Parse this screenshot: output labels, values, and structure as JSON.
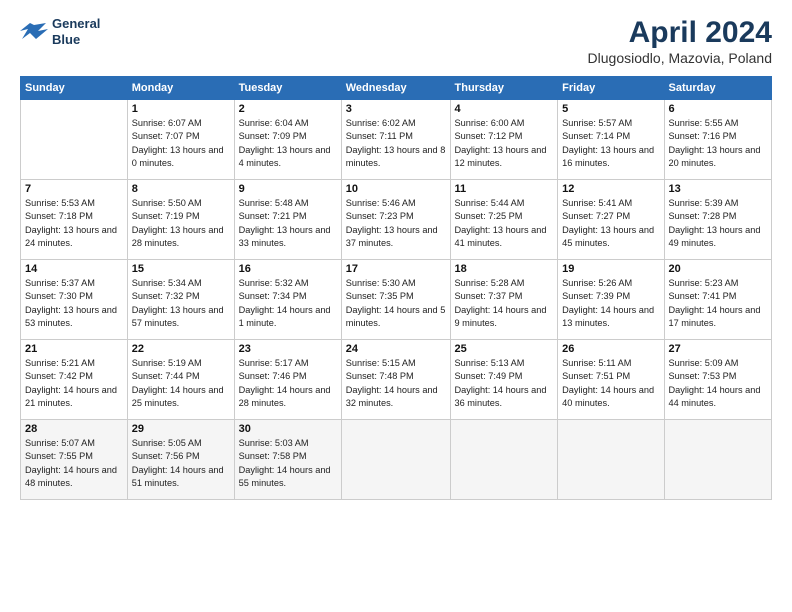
{
  "header": {
    "logo_line1": "General",
    "logo_line2": "Blue",
    "month": "April 2024",
    "location": "Dlugosiodlo, Mazovia, Poland"
  },
  "days_of_week": [
    "Sunday",
    "Monday",
    "Tuesday",
    "Wednesday",
    "Thursday",
    "Friday",
    "Saturday"
  ],
  "weeks": [
    [
      {
        "day": "",
        "sunrise": "",
        "sunset": "",
        "daylight": ""
      },
      {
        "day": "1",
        "sunrise": "Sunrise: 6:07 AM",
        "sunset": "Sunset: 7:07 PM",
        "daylight": "Daylight: 13 hours and 0 minutes."
      },
      {
        "day": "2",
        "sunrise": "Sunrise: 6:04 AM",
        "sunset": "Sunset: 7:09 PM",
        "daylight": "Daylight: 13 hours and 4 minutes."
      },
      {
        "day": "3",
        "sunrise": "Sunrise: 6:02 AM",
        "sunset": "Sunset: 7:11 PM",
        "daylight": "Daylight: 13 hours and 8 minutes."
      },
      {
        "day": "4",
        "sunrise": "Sunrise: 6:00 AM",
        "sunset": "Sunset: 7:12 PM",
        "daylight": "Daylight: 13 hours and 12 minutes."
      },
      {
        "day": "5",
        "sunrise": "Sunrise: 5:57 AM",
        "sunset": "Sunset: 7:14 PM",
        "daylight": "Daylight: 13 hours and 16 minutes."
      },
      {
        "day": "6",
        "sunrise": "Sunrise: 5:55 AM",
        "sunset": "Sunset: 7:16 PM",
        "daylight": "Daylight: 13 hours and 20 minutes."
      }
    ],
    [
      {
        "day": "7",
        "sunrise": "Sunrise: 5:53 AM",
        "sunset": "Sunset: 7:18 PM",
        "daylight": "Daylight: 13 hours and 24 minutes."
      },
      {
        "day": "8",
        "sunrise": "Sunrise: 5:50 AM",
        "sunset": "Sunset: 7:19 PM",
        "daylight": "Daylight: 13 hours and 28 minutes."
      },
      {
        "day": "9",
        "sunrise": "Sunrise: 5:48 AM",
        "sunset": "Sunset: 7:21 PM",
        "daylight": "Daylight: 13 hours and 33 minutes."
      },
      {
        "day": "10",
        "sunrise": "Sunrise: 5:46 AM",
        "sunset": "Sunset: 7:23 PM",
        "daylight": "Daylight: 13 hours and 37 minutes."
      },
      {
        "day": "11",
        "sunrise": "Sunrise: 5:44 AM",
        "sunset": "Sunset: 7:25 PM",
        "daylight": "Daylight: 13 hours and 41 minutes."
      },
      {
        "day": "12",
        "sunrise": "Sunrise: 5:41 AM",
        "sunset": "Sunset: 7:27 PM",
        "daylight": "Daylight: 13 hours and 45 minutes."
      },
      {
        "day": "13",
        "sunrise": "Sunrise: 5:39 AM",
        "sunset": "Sunset: 7:28 PM",
        "daylight": "Daylight: 13 hours and 49 minutes."
      }
    ],
    [
      {
        "day": "14",
        "sunrise": "Sunrise: 5:37 AM",
        "sunset": "Sunset: 7:30 PM",
        "daylight": "Daylight: 13 hours and 53 minutes."
      },
      {
        "day": "15",
        "sunrise": "Sunrise: 5:34 AM",
        "sunset": "Sunset: 7:32 PM",
        "daylight": "Daylight: 13 hours and 57 minutes."
      },
      {
        "day": "16",
        "sunrise": "Sunrise: 5:32 AM",
        "sunset": "Sunset: 7:34 PM",
        "daylight": "Daylight: 14 hours and 1 minute."
      },
      {
        "day": "17",
        "sunrise": "Sunrise: 5:30 AM",
        "sunset": "Sunset: 7:35 PM",
        "daylight": "Daylight: 14 hours and 5 minutes."
      },
      {
        "day": "18",
        "sunrise": "Sunrise: 5:28 AM",
        "sunset": "Sunset: 7:37 PM",
        "daylight": "Daylight: 14 hours and 9 minutes."
      },
      {
        "day": "19",
        "sunrise": "Sunrise: 5:26 AM",
        "sunset": "Sunset: 7:39 PM",
        "daylight": "Daylight: 14 hours and 13 minutes."
      },
      {
        "day": "20",
        "sunrise": "Sunrise: 5:23 AM",
        "sunset": "Sunset: 7:41 PM",
        "daylight": "Daylight: 14 hours and 17 minutes."
      }
    ],
    [
      {
        "day": "21",
        "sunrise": "Sunrise: 5:21 AM",
        "sunset": "Sunset: 7:42 PM",
        "daylight": "Daylight: 14 hours and 21 minutes."
      },
      {
        "day": "22",
        "sunrise": "Sunrise: 5:19 AM",
        "sunset": "Sunset: 7:44 PM",
        "daylight": "Daylight: 14 hours and 25 minutes."
      },
      {
        "day": "23",
        "sunrise": "Sunrise: 5:17 AM",
        "sunset": "Sunset: 7:46 PM",
        "daylight": "Daylight: 14 hours and 28 minutes."
      },
      {
        "day": "24",
        "sunrise": "Sunrise: 5:15 AM",
        "sunset": "Sunset: 7:48 PM",
        "daylight": "Daylight: 14 hours and 32 minutes."
      },
      {
        "day": "25",
        "sunrise": "Sunrise: 5:13 AM",
        "sunset": "Sunset: 7:49 PM",
        "daylight": "Daylight: 14 hours and 36 minutes."
      },
      {
        "day": "26",
        "sunrise": "Sunrise: 5:11 AM",
        "sunset": "Sunset: 7:51 PM",
        "daylight": "Daylight: 14 hours and 40 minutes."
      },
      {
        "day": "27",
        "sunrise": "Sunrise: 5:09 AM",
        "sunset": "Sunset: 7:53 PM",
        "daylight": "Daylight: 14 hours and 44 minutes."
      }
    ],
    [
      {
        "day": "28",
        "sunrise": "Sunrise: 5:07 AM",
        "sunset": "Sunset: 7:55 PM",
        "daylight": "Daylight: 14 hours and 48 minutes."
      },
      {
        "day": "29",
        "sunrise": "Sunrise: 5:05 AM",
        "sunset": "Sunset: 7:56 PM",
        "daylight": "Daylight: 14 hours and 51 minutes."
      },
      {
        "day": "30",
        "sunrise": "Sunrise: 5:03 AM",
        "sunset": "Sunset: 7:58 PM",
        "daylight": "Daylight: 14 hours and 55 minutes."
      },
      {
        "day": "",
        "sunrise": "",
        "sunset": "",
        "daylight": ""
      },
      {
        "day": "",
        "sunrise": "",
        "sunset": "",
        "daylight": ""
      },
      {
        "day": "",
        "sunrise": "",
        "sunset": "",
        "daylight": ""
      },
      {
        "day": "",
        "sunrise": "",
        "sunset": "",
        "daylight": ""
      }
    ]
  ]
}
